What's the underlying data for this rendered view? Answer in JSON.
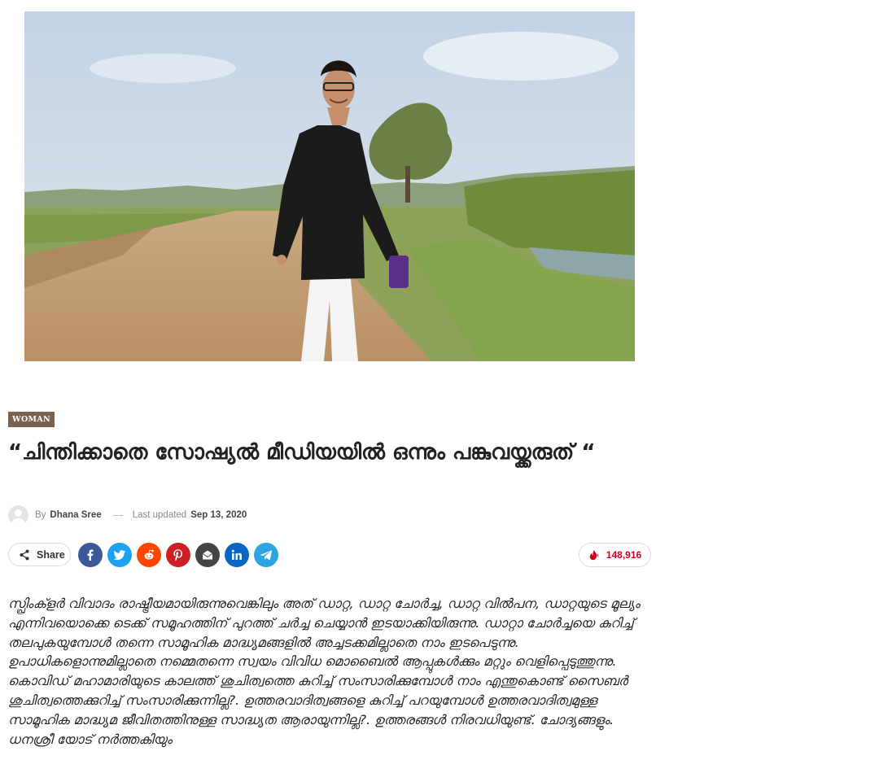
{
  "article": {
    "category": "WOMAN",
    "title": "“ചിന്തിക്കാതെ സോഷ്യൽ മീഡിയയിൽ ഒന്നും പങ്കുവയ്ക്കരുത് “",
    "author_prefix": "By",
    "author": "Dhana Sree",
    "updated_label": "Last updated",
    "updated_date": "Sep 13, 2020",
    "body": "സ്പ്രിംക്ളർ വിവാദം രാഷ്ട്രീയമായിരുന്നുവെങ്കിലും അത് ഡാറ്റ, ഡാറ്റ ചോർച്ച, ഡാറ്റ വിൽപന, ഡാറ്റയുടെ മൂല്യം എന്നിവയൊക്കെ ടെക്ക് സമൂഹത്തിന് പുറത്ത് ചർച്ച ചെയ്യാൻ ഇടയാക്കിയിരുന്നു. ഡാറ്റാ ചോർച്ചയെ കുറിച്ച് തലപുകയുമ്പോൾ തന്നെ സാമൂഹിക മാദ്ധ്യമങ്ങളിൽ അച്ചടക്കമില്ലാതെ നാം ഇടപെടുന്നു. ഉപാധികളൊന്നുമില്ലാതെ നമ്മെതന്നെ സ്വയം വിവിധ മൊബൈൽ ആപ്പുകൾക്കും മറ്റും വെളിപ്പെടുത്തുന്നു. കൊവിഡ് മഹാമാരിയുടെ കാലത്ത് ശുചിത്വത്തെ കുറിച്ച് സംസാരിക്കുമ്പോൾ നാം എന്തുകൊണ്ട് സൈബർ ശുചിത്വത്തെക്കുറിച്ച് സംസാരിക്കുന്നില്ല?. ഉത്തരവാദിത്വങ്ങളെ കുറിച്ച് പറയുമ്പോൾ ഉത്തരവാദിത്വമുള്ള സാമൂഹിക മാദ്ധ്യമ ജീവിതത്തിനുള്ള സാദ്ധ്യത ആരായുന്നില്ല?. ഉത്തരങ്ങൾ നിരവധിയുണ്ട്. ചോദ്യങ്ങളും. ധനശ്രീ യോട് നർത്തകിയും"
  },
  "share": {
    "label": "Share",
    "views": "148,916",
    "networks": [
      {
        "name": "facebook",
        "color": "#3b5998"
      },
      {
        "name": "twitter",
        "color": "#1da1f2"
      },
      {
        "name": "reddit",
        "color": "#ff4500"
      },
      {
        "name": "pinterest",
        "color": "#cb2027"
      },
      {
        "name": "email",
        "color": "#444444"
      },
      {
        "name": "linkedin",
        "color": "#0a66c2"
      },
      {
        "name": "telegram",
        "color": "#2ca5e0"
      }
    ]
  }
}
